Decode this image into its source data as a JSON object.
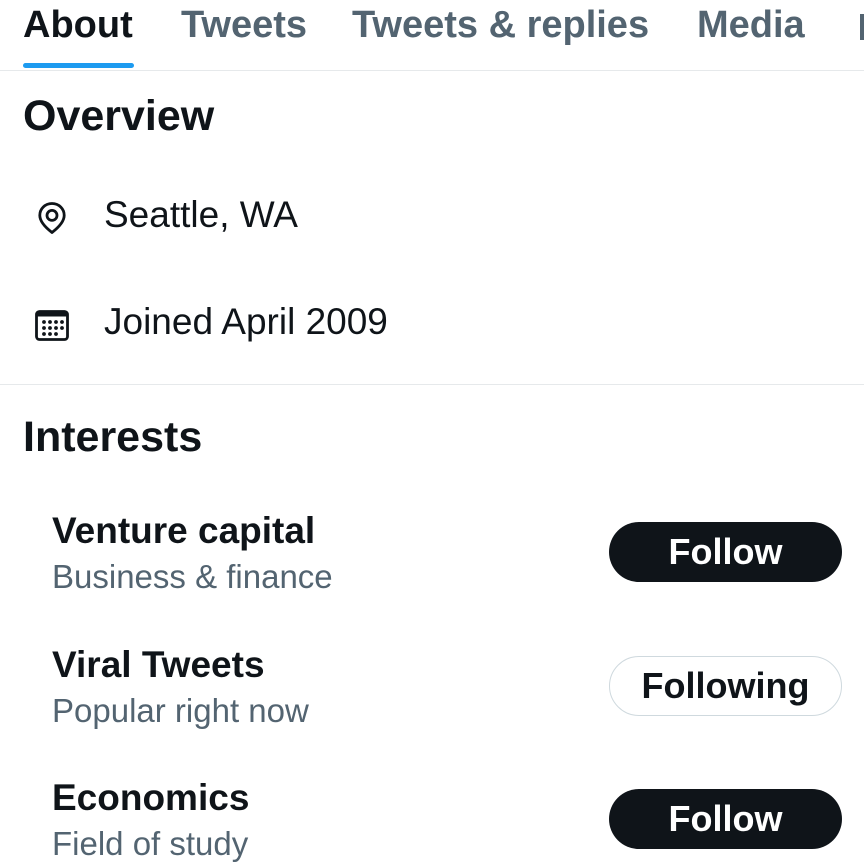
{
  "tabs": [
    {
      "label": "About",
      "active": true
    },
    {
      "label": "Tweets",
      "active": false
    },
    {
      "label": "Tweets & replies",
      "active": false
    },
    {
      "label": "Media",
      "active": false
    }
  ],
  "overview": {
    "title": "Overview",
    "location": {
      "icon": "location-pin-icon",
      "text": "Seattle, WA"
    },
    "joined": {
      "icon": "calendar-icon",
      "text": "Joined April 2009"
    }
  },
  "interests": {
    "title": "Interests",
    "items": [
      {
        "name": "Venture capital",
        "category": "Business & finance",
        "button": "Follow",
        "following": false
      },
      {
        "name": "Viral Tweets",
        "category": "Popular right now",
        "button": "Following",
        "following": true
      },
      {
        "name": "Economics",
        "category": "Field of study",
        "button": "Follow",
        "following": false
      }
    ]
  },
  "colors": {
    "text_primary": "#0f1419",
    "text_secondary": "#536471",
    "accent": "#1d9bf0",
    "divider": "#e6e9eb",
    "follow_button_bg": "#0f1419",
    "following_border": "#cfd9de"
  }
}
